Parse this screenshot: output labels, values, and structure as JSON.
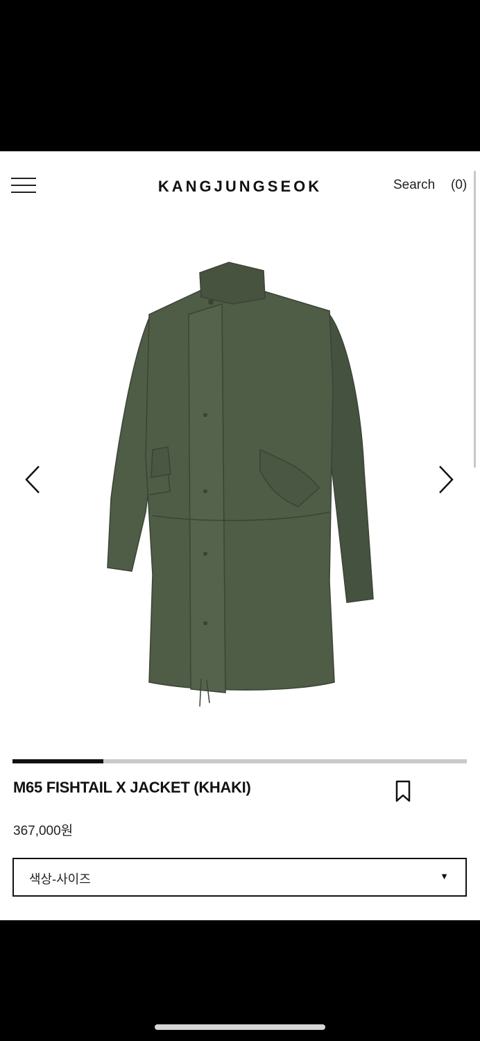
{
  "header": {
    "brand": "KANGJUNGSEOK",
    "search_label": "Search",
    "cart_count": "(0)",
    "menu_icon": "hamburger-menu-icon"
  },
  "gallery": {
    "image_alt": "M65 FISHTAIL X JACKET (KHAKI)",
    "prev_icon": "chevron-left-icon",
    "next_icon": "chevron-right-icon",
    "progress": 0.2,
    "jacket_color": "#4f5c46"
  },
  "product": {
    "name": "M65 FISHTAIL X JACKET (KHAKI)",
    "price": "367,000원",
    "bookmark_icon": "bookmark-icon"
  },
  "option_select": {
    "selected": "색상-사이즈"
  }
}
